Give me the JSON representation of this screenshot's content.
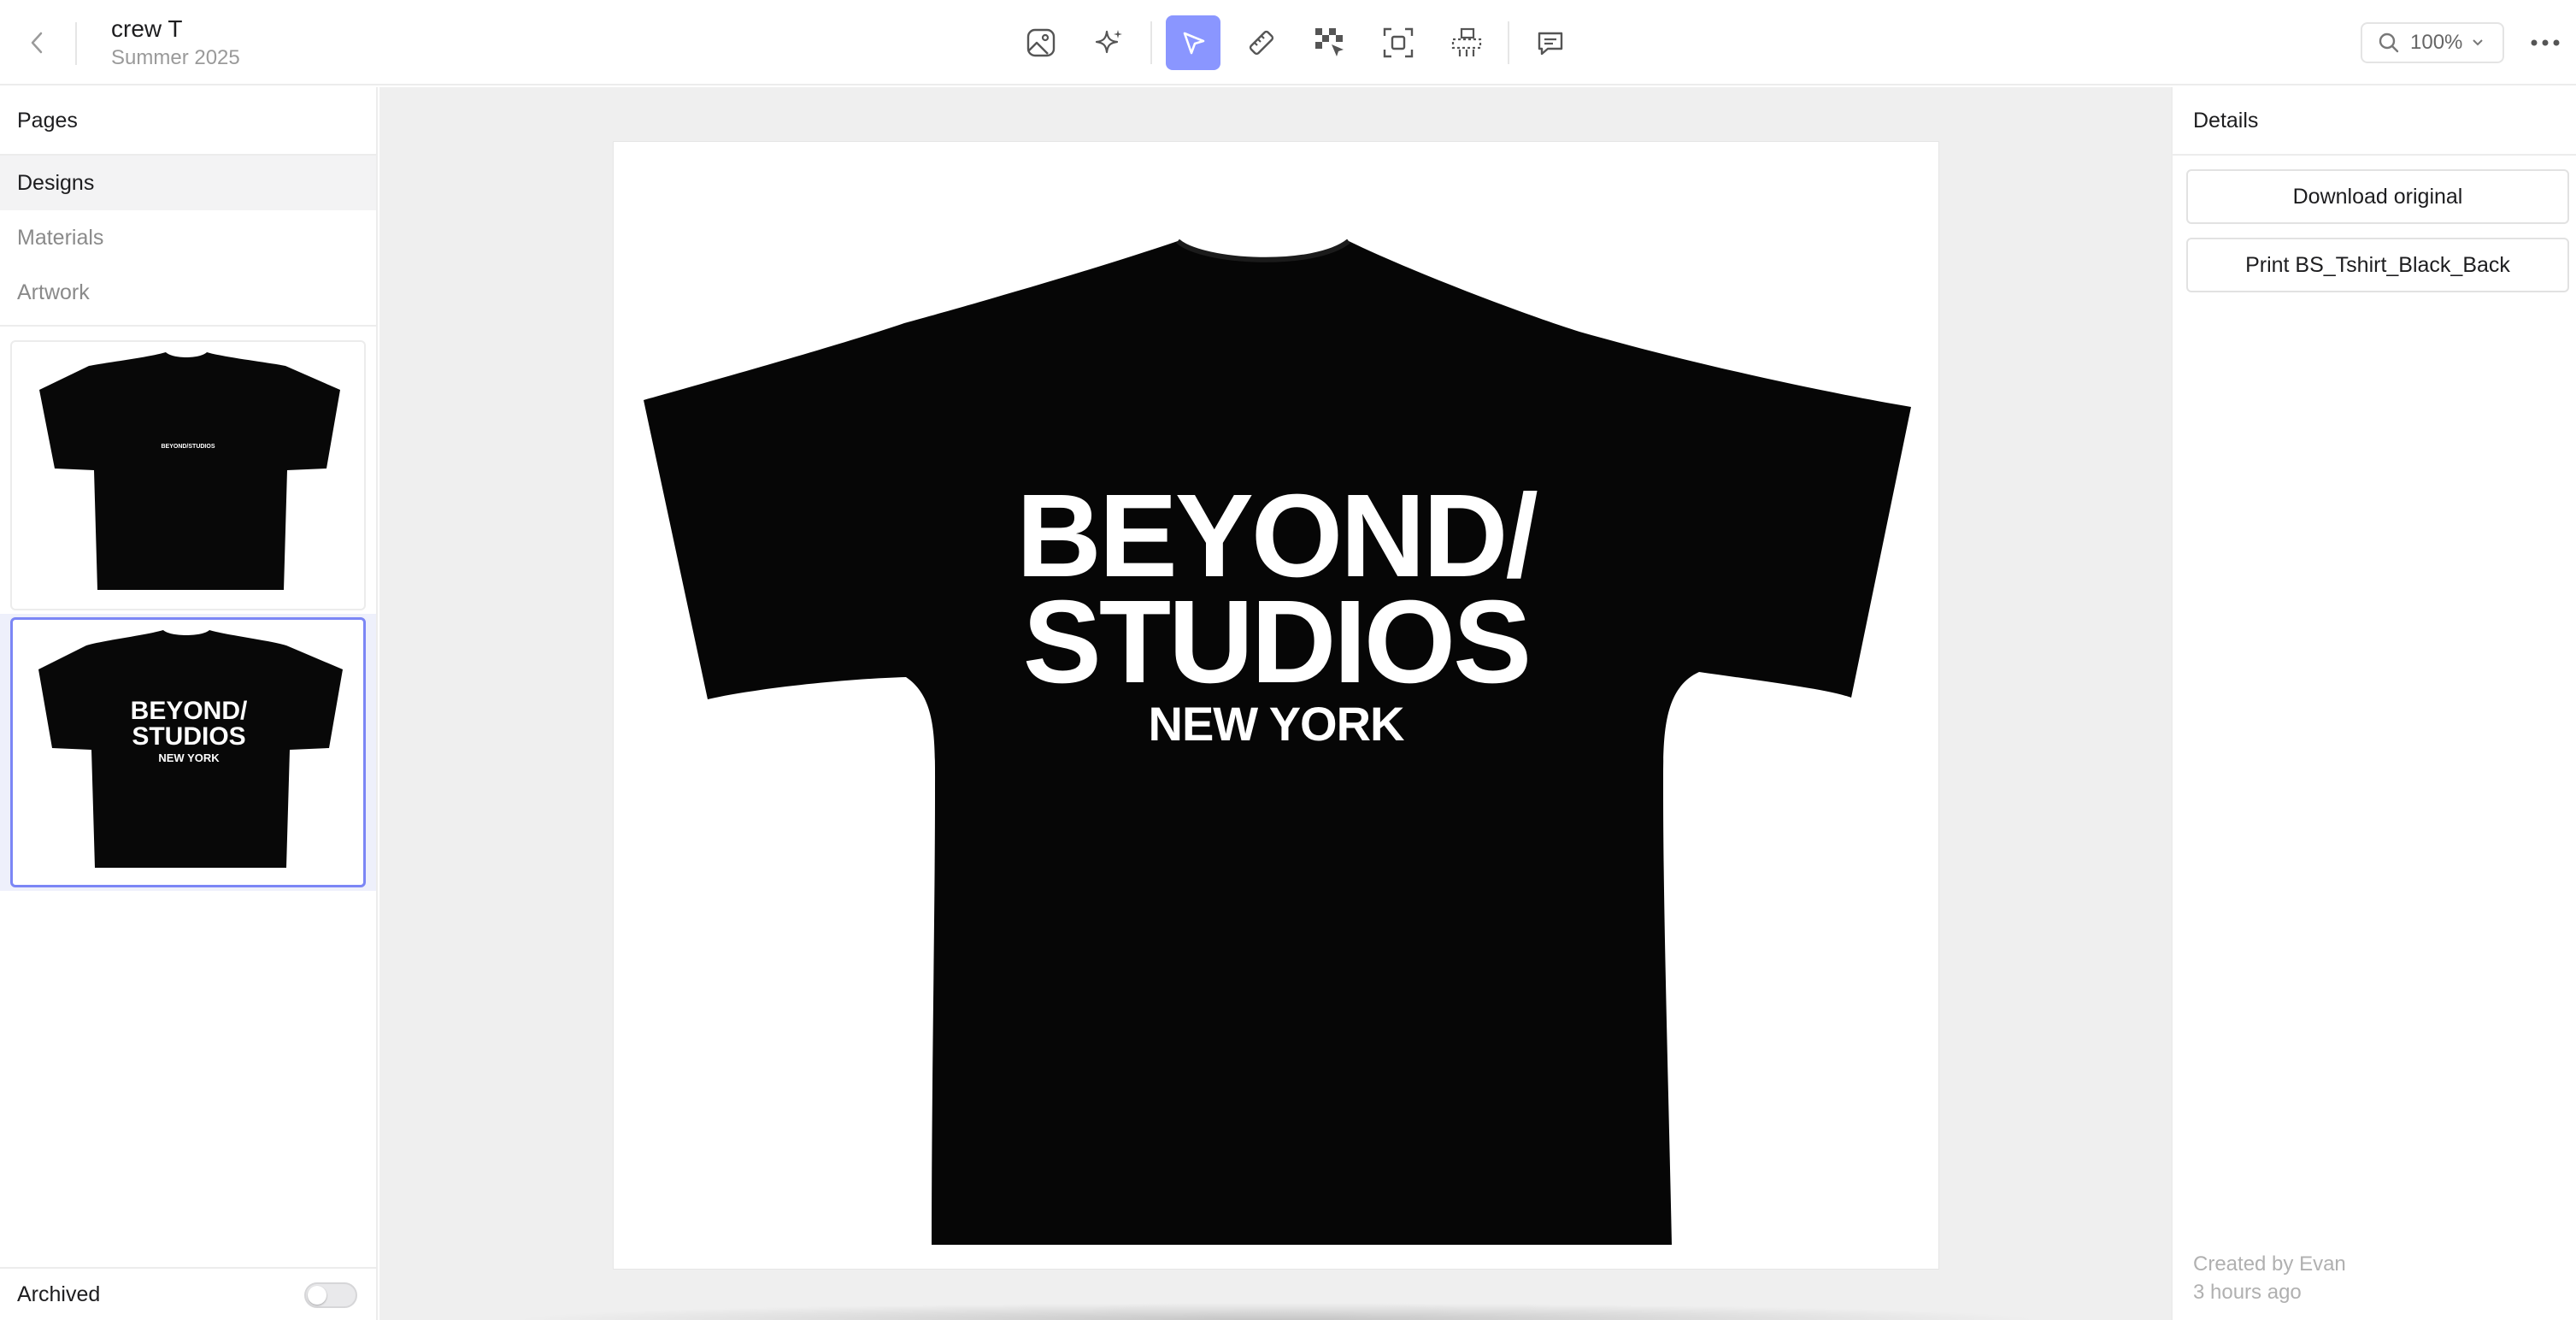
{
  "header": {
    "title": "crew T",
    "subtitle": "Summer 2025",
    "zoom": "100%"
  },
  "toolbar": {
    "tools": [
      {
        "icon": "image-icon"
      },
      {
        "icon": "sparkle-icon"
      },
      {
        "icon": "pointer-icon",
        "active": true
      },
      {
        "icon": "ruler-icon"
      },
      {
        "icon": "checker-cursor-icon"
      },
      {
        "icon": "focus-frame-icon"
      },
      {
        "icon": "tag-icon"
      },
      {
        "icon": "comment-icon"
      }
    ],
    "active_color": "#8a96ff"
  },
  "sidebar": {
    "header": "Pages",
    "pages": [
      {
        "label": "Designs",
        "selected": true
      },
      {
        "label": "Materials",
        "selected": false
      },
      {
        "label": "Artwork",
        "selected": false
      }
    ],
    "thumbnails": [
      {
        "name": "front",
        "print": "BEYOND/STUDIOS"
      },
      {
        "name": "back",
        "print_lines": [
          "BEYOND/",
          "STUDIOS",
          "NEW YORK"
        ],
        "selected": true
      }
    ],
    "archived_label": "Archived",
    "archived_on": false
  },
  "canvas": {
    "print_lines": [
      "BEYOND/",
      "STUDIOS",
      "NEW YORK"
    ]
  },
  "details": {
    "header": "Details",
    "download_label": "Download original",
    "print_label": "Print BS_Tshirt_Black_Back",
    "created_by": "Created by Evan",
    "created_when": "3 hours ago"
  }
}
